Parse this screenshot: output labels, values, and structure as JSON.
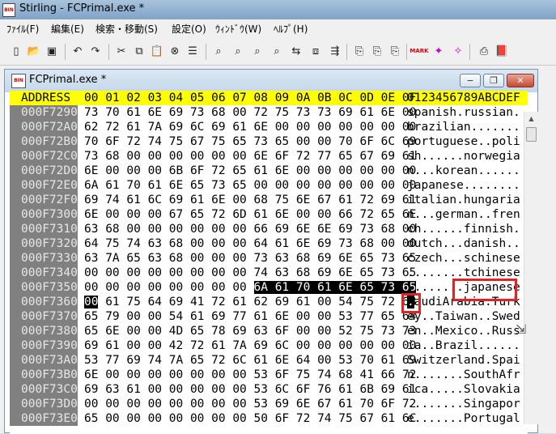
{
  "app": {
    "icon_label": "BIN",
    "title": "Stirling - FCPrimal.exe *"
  },
  "menu": [
    "ﾌｧｲﾙ(F)",
    "編集(E)",
    "検索・移動(S)",
    "設定(O)",
    "ｳｨﾝﾄﾞｳ(W)",
    "ﾍﾙﾌﾟ(H)"
  ],
  "toolbar": {
    "icons": [
      {
        "name": "new-file-icon",
        "glyph": "▯"
      },
      {
        "name": "open-folder-icon",
        "glyph": "📂"
      },
      {
        "name": "save-icon",
        "glyph": "▣"
      },
      {
        "name": "undo-icon",
        "glyph": "↶"
      },
      {
        "name": "redo-icon",
        "glyph": "↷"
      },
      {
        "name": "cut-icon",
        "glyph": "✂"
      },
      {
        "name": "copy-icon",
        "glyph": "⧉"
      },
      {
        "name": "paste-icon",
        "glyph": "📋"
      },
      {
        "name": "delete-icon",
        "glyph": "⊗"
      },
      {
        "name": "list-icon",
        "glyph": "☰"
      },
      {
        "name": "find-icon",
        "glyph": "⌕"
      },
      {
        "name": "find-next-icon",
        "glyph": "⌕"
      },
      {
        "name": "find-down-icon",
        "glyph": "⌕"
      },
      {
        "name": "find-up-icon",
        "glyph": "⌕"
      },
      {
        "name": "replace-icon",
        "glyph": "⇆"
      },
      {
        "name": "compare-icon",
        "glyph": "⧈"
      },
      {
        "name": "jump-icon",
        "glyph": "⇶"
      },
      {
        "name": "bookmark-icon",
        "glyph": "MARK"
      },
      {
        "name": "bookmark-next-icon",
        "glyph": "✦"
      },
      {
        "name": "bookmark-prev-icon",
        "glyph": "✧"
      },
      {
        "name": "print-icon",
        "glyph": "⎙"
      },
      {
        "name": "book-icon",
        "glyph": "📕"
      }
    ]
  },
  "child_window": {
    "icon_label": "BIN",
    "title": "FCPrimal.exe *",
    "minimize_glyph": "−",
    "restore_glyph": "❐",
    "close_glyph": "✕"
  },
  "hex_view": {
    "header": {
      "address": "ADDRESS",
      "hex": "00 01 02 03 04 05 06 07 08 09 0A 0B 0C 0D 0E 0F",
      "ascii": "0123456789ABCDEF"
    },
    "rows": [
      {
        "address": "000F7290",
        "hex": "73 70 61 6E 69 73 68 00 72 75 73 73 69 61 6E 00",
        "ascii": "spanish.russian."
      },
      {
        "address": "000F72A0",
        "hex": "62 72 61 7A 69 6C 69 61 6E 00 00 00 00 00 00 00",
        "ascii": "brazilian......."
      },
      {
        "address": "000F72B0",
        "hex": "70 6F 72 74 75 67 75 65 73 65 00 00 70 6F 6C 69",
        "ascii": "portuguese..poli"
      },
      {
        "address": "000F72C0",
        "hex": "73 68 00 00 00 00 00 00 6E 6F 72 77 65 67 69 61",
        "ascii": "sh......norwegia"
      },
      {
        "address": "000F72D0",
        "hex": "6E 00 00 00 6B 6F 72 65 61 6E 00 00 00 00 00 00",
        "ascii": "n...korean......"
      },
      {
        "address": "000F72E0",
        "hex": "6A 61 70 61 6E 65 73 65 00 00 00 00 00 00 00 00",
        "ascii": "japanese........"
      },
      {
        "address": "000F72F0",
        "hex": "69 74 61 6C 69 61 6E 00 68 75 6E 67 61 72 69 61",
        "ascii": "italian.hungaria"
      },
      {
        "address": "000F7300",
        "hex": "6E 00 00 00 67 65 72 6D 61 6E 00 00 66 72 65 6E",
        "ascii": "n...german..fren"
      },
      {
        "address": "000F7310",
        "hex": "63 68 00 00 00 00 00 00 66 69 6E 6E 69 73 68 00",
        "ascii": "ch......finnish."
      },
      {
        "address": "000F7320",
        "hex": "64 75 74 63 68 00 00 00 64 61 6E 69 73 68 00 00",
        "ascii": "dutch...danish.."
      },
      {
        "address": "000F7330",
        "hex": "63 7A 65 63 68 00 00 00 73 63 68 69 6E 65 73 65",
        "ascii": "czech...schinese"
      },
      {
        "address": "000F7340",
        "hex": "00 00 00 00 00 00 00 00 74 63 68 69 6E 65 73 65",
        "ascii": "........tchinese"
      },
      {
        "address": "000F7350",
        "hex_normal": "00 00 00 00 00 00 00 00 ",
        "hex_selected": "6A 61 70 61 6E 65 73 65",
        "ascii_normal": "........",
        "ascii_selected": "japanese"
      },
      {
        "address": "000F7360",
        "hex_selected": "00",
        "hex_normal": " 61 75 64 69 41 72 61 62 69 61 00 54 75 72 6B",
        "ascii_selected": ".",
        "ascii_normal": "audiArabia.Turk"
      },
      {
        "address": "000F7370",
        "hex": "65 79 00 00 54 61 69 77 61 6E 00 00 53 77 65 64",
        "ascii": "ey..Taiwan..Swed"
      },
      {
        "address": "000F7380",
        "hex": "65 6E 00 00 4D 65 78 69 63 6F 00 00 52 75 73 73",
        "ascii": "en..Mexico..Russ"
      },
      {
        "address": "000F7390",
        "hex": "69 61 00 00 42 72 61 7A 69 6C 00 00 00 00 00 00",
        "ascii": "ia..Brazil......"
      },
      {
        "address": "000F73A0",
        "hex": "53 77 69 74 7A 65 72 6C 61 6E 64 00 53 70 61 69",
        "ascii": "Switzerland.Spai"
      },
      {
        "address": "000F73B0",
        "hex": "6E 00 00 00 00 00 00 00 53 6F 75 74 68 41 66 72",
        "ascii": "n.......SouthAfr"
      },
      {
        "address": "000F73C0",
        "hex": "69 63 61 00 00 00 00 00 53 6C 6F 76 61 6B 69 61",
        "ascii": "ica.....Slovakia"
      },
      {
        "address": "000F73D0",
        "hex": "00 00 00 00 00 00 00 00 53 69 6E 67 61 70 6F 72",
        "ascii": "........Singapor"
      },
      {
        "address": "000F73E0",
        "hex": "65 00 00 00 00 00 00 00 50 6F 72 74 75 67 61 6C",
        "ascii": "e.......Portugal"
      }
    ]
  },
  "colors": {
    "header_bg": "#ffff00",
    "address_bg": "#808080",
    "selection_bg": "#000000",
    "annotation_box": "#e52222"
  }
}
